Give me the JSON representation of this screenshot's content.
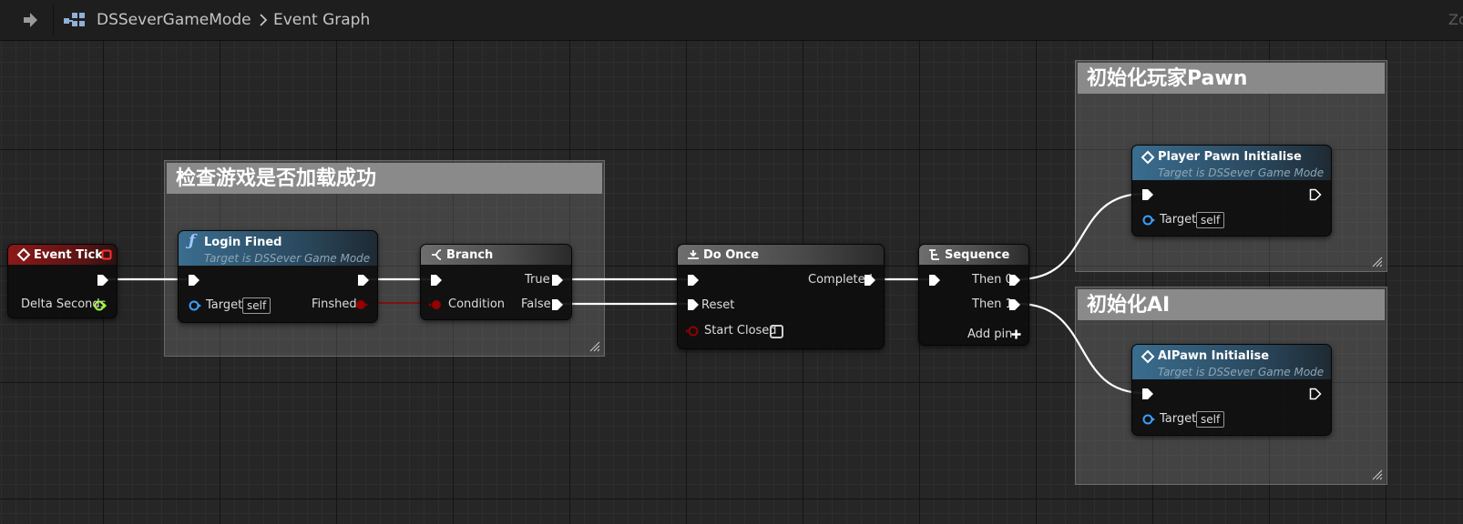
{
  "breadcrumb": {
    "blueprint": "DSSeverGameMode",
    "graph": "Event Graph",
    "zoom_fragment": "Zc"
  },
  "comments": [
    {
      "title": "检查游戏是否加载成功"
    },
    {
      "title": "初始化玩家Pawn"
    },
    {
      "title": "初始化AI"
    }
  ],
  "nodes": {
    "event_tick": {
      "title": "Event Tick",
      "pin_delta": "Delta Seconds"
    },
    "login": {
      "title": "Login Fined",
      "subtitle": "Target is DSSever Game Mode",
      "pin_target": "Target",
      "self": "self",
      "pin_finshed": "Finshed"
    },
    "branch": {
      "title": "Branch",
      "pin_condition": "Condition",
      "pin_true": "True",
      "pin_false": "False"
    },
    "do_once": {
      "title": "Do Once",
      "pin_completed": "Completed",
      "pin_reset": "Reset",
      "pin_start_closed": "Start Closed"
    },
    "sequence": {
      "title": "Sequence",
      "pin_then0": "Then 0",
      "pin_then1": "Then 1",
      "add_pin": "Add pin"
    },
    "player_pawn": {
      "title": "Player Pawn Initialise",
      "subtitle": "Target is DSSever Game Mode",
      "pin_target": "Target",
      "self": "self"
    },
    "ai_pawn": {
      "title": "AIPawn Initialise",
      "subtitle": "Target is DSSever Game Mode",
      "pin_target": "Target",
      "self": "self"
    }
  },
  "colors": {
    "exec_wire": "#ffffff",
    "bool_wire": "#950000",
    "float_pin": "#a0ff3c",
    "object_pin": "#3aa0ff",
    "event_header": "#8c1818",
    "function_header": "#3a6d8f",
    "macro_header": "#6e6e6e"
  }
}
